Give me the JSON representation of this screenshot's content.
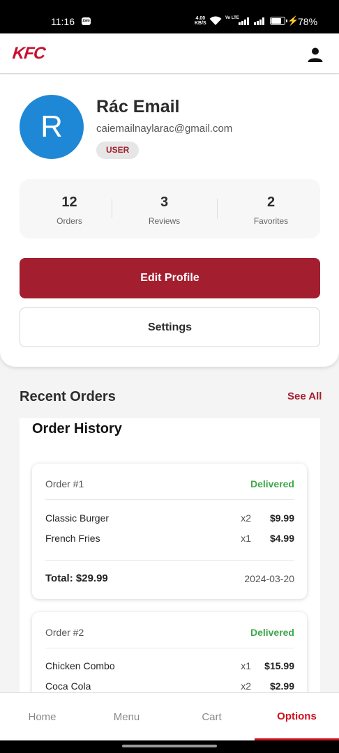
{
  "status_bar": {
    "time": "11:16",
    "zalo_badge": "Zalo",
    "net_speed_value": "4.00",
    "net_speed_unit": "KB/S",
    "volte": "Vo LTE",
    "battery": "78%"
  },
  "app_bar": {
    "logo": "KFC",
    "account_icon": "person-icon"
  },
  "profile": {
    "avatar_letter": "R",
    "name": "Rác Email",
    "email": "caiemailnaylarac@gmail.com",
    "role": "USER"
  },
  "stats": [
    {
      "value": "12",
      "label": "Orders"
    },
    {
      "value": "3",
      "label": "Reviews"
    },
    {
      "value": "2",
      "label": "Favorites"
    }
  ],
  "actions": {
    "edit_profile": "Edit Profile",
    "settings": "Settings"
  },
  "recent_orders": {
    "title": "Recent Orders",
    "see_all": "See All",
    "history_title": "Order History",
    "orders": [
      {
        "id": "Order #1",
        "status": "Delivered",
        "items": [
          {
            "name": "Classic Burger",
            "qty": "x2",
            "price": "$9.99"
          },
          {
            "name": "French Fries",
            "qty": "x1",
            "price": "$4.99"
          }
        ],
        "total": "Total: $29.99",
        "date": "2024-03-20"
      },
      {
        "id": "Order #2",
        "status": "Delivered",
        "items": [
          {
            "name": "Chicken Combo",
            "qty": "x1",
            "price": "$15.99"
          },
          {
            "name": "Coca Cola",
            "qty": "x2",
            "price": "$2.99"
          }
        ]
      }
    ]
  },
  "bottom_nav": {
    "items": [
      "Home",
      "Menu",
      "Cart",
      "Options"
    ],
    "active": "Options"
  },
  "colors": {
    "brand_red": "#a31f2f",
    "nav_active": "#d0101e",
    "delivered_green": "#3ea84a",
    "avatar_blue": "#1f88d6"
  }
}
